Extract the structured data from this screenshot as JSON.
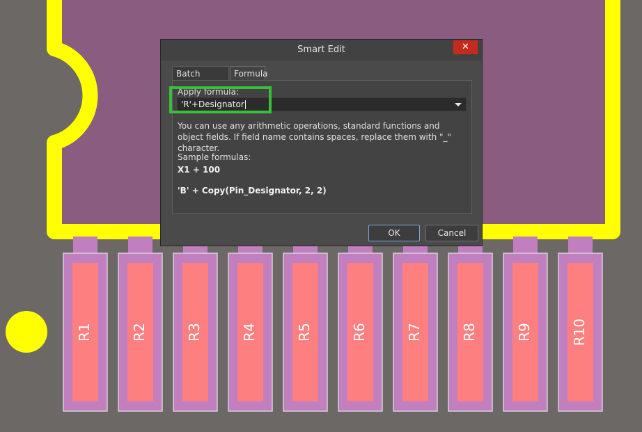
{
  "board": {
    "colors": {
      "background": "#6b6866",
      "copper": "#ffff00",
      "fill": "#8a5c80",
      "pad": "#c27fc0",
      "pad_inner": "#fe7f80"
    },
    "designators": [
      "R1",
      "R2",
      "R3",
      "R4",
      "R5",
      "R6",
      "R7",
      "R8",
      "R9",
      "R10"
    ]
  },
  "dialog": {
    "title": "Smart Edit",
    "close_icon": "close-icon",
    "close_glyph": "✕",
    "tabs": [
      {
        "label": "Batch Replace"
      },
      {
        "label": "Formula"
      }
    ],
    "active_tab": "Formula",
    "apply_label": "Apply formula:",
    "formula_value": "'R'+Designator",
    "hint": "You can use any arithmetic operations, standard functions and object fields. If field name contains spaces, replace them with \"_\" character.",
    "samples_heading": "Sample formulas:",
    "samples": [
      "X1 + 100",
      "'B' + Copy(Pin_Designator, 2, 2)"
    ],
    "ok_label": "OK",
    "cancel_label": "Cancel",
    "highlight_color": "#38c03a"
  }
}
